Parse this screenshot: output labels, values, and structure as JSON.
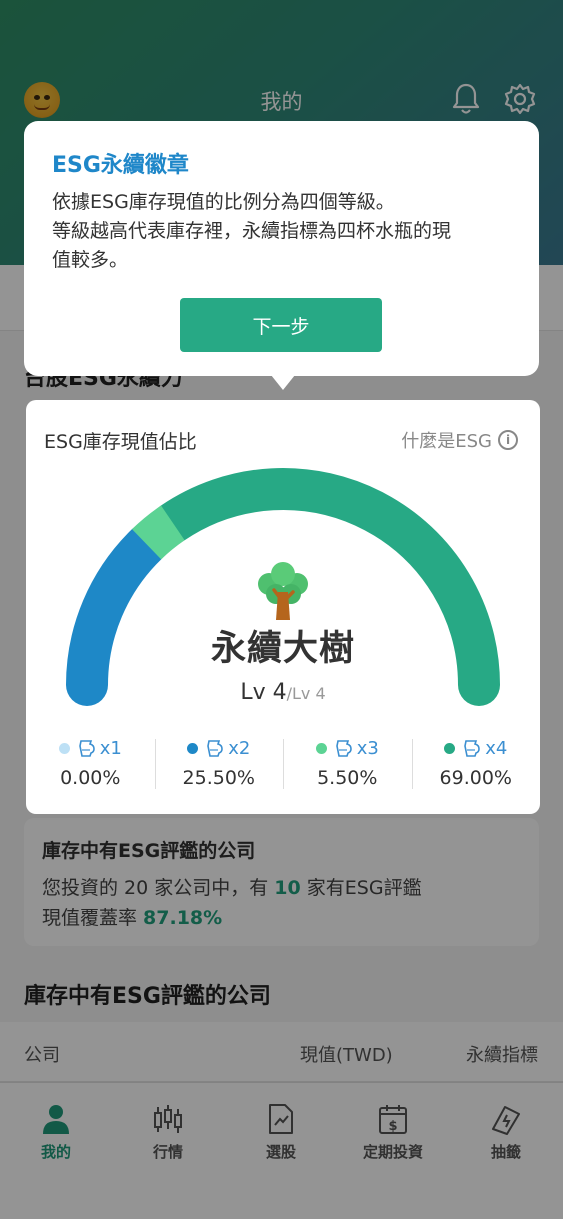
{
  "header": {
    "title": "我的"
  },
  "section": {
    "title": "台股ESG永續力"
  },
  "tooltip": {
    "title": "ESG永續徽章",
    "body_line1": "依據ESG庫存現值的比例分為四個等級。",
    "body_line2": "等級越高代表庫存裡，永續指標為四杯水瓶的現",
    "body_line3": "值較多。",
    "next_label": "下一步"
  },
  "esg_card": {
    "title": "ESG庫存現值佔比",
    "what_link": "什麼是ESG",
    "badge_name": "永續大樹",
    "level": "Lv 4",
    "level_max": "/Lv 4",
    "gauge_segments": [
      {
        "label": "x2",
        "fraction": 0.255,
        "color": "#1e88c7"
      },
      {
        "label": "x3",
        "fraction": 0.055,
        "color": "#5cd394"
      },
      {
        "label": "x4",
        "fraction": 0.69,
        "color": "#27a985"
      }
    ],
    "levels": [
      {
        "dot_color": "#bde0f5",
        "multiplier": "x1",
        "percent": "0.00%"
      },
      {
        "dot_color": "#1e88c7",
        "multiplier": "x2",
        "percent": "25.50%"
      },
      {
        "dot_color": "#5cd394",
        "multiplier": "x3",
        "percent": "5.50%"
      },
      {
        "dot_color": "#27a985",
        "multiplier": "x4",
        "percent": "69.00%"
      }
    ]
  },
  "coverage": {
    "title": "庫存中有ESG評鑑的公司",
    "line1_a": "您投資的 20 家公司中，有 ",
    "line1_count": "10",
    "line1_b": " 家有ESG評鑑",
    "line2_a": "現值覆蓋率 ",
    "line2_rate": "87.18%"
  },
  "companies": {
    "title": "庫存中有ESG評鑑的公司",
    "col_company": "公司",
    "col_value": "現值(TWD)",
    "col_indicator": "永續指標"
  },
  "bottom_nav": [
    {
      "label": "我的",
      "icon": "person-icon",
      "active": true
    },
    {
      "label": "行情",
      "icon": "candlestick-icon",
      "active": false
    },
    {
      "label": "選股",
      "icon": "stock-pick-icon",
      "active": false
    },
    {
      "label": "定期投資",
      "icon": "calendar-dollar-icon",
      "active": false
    },
    {
      "label": "抽籤",
      "icon": "lottery-ticket-icon",
      "active": false
    }
  ]
}
